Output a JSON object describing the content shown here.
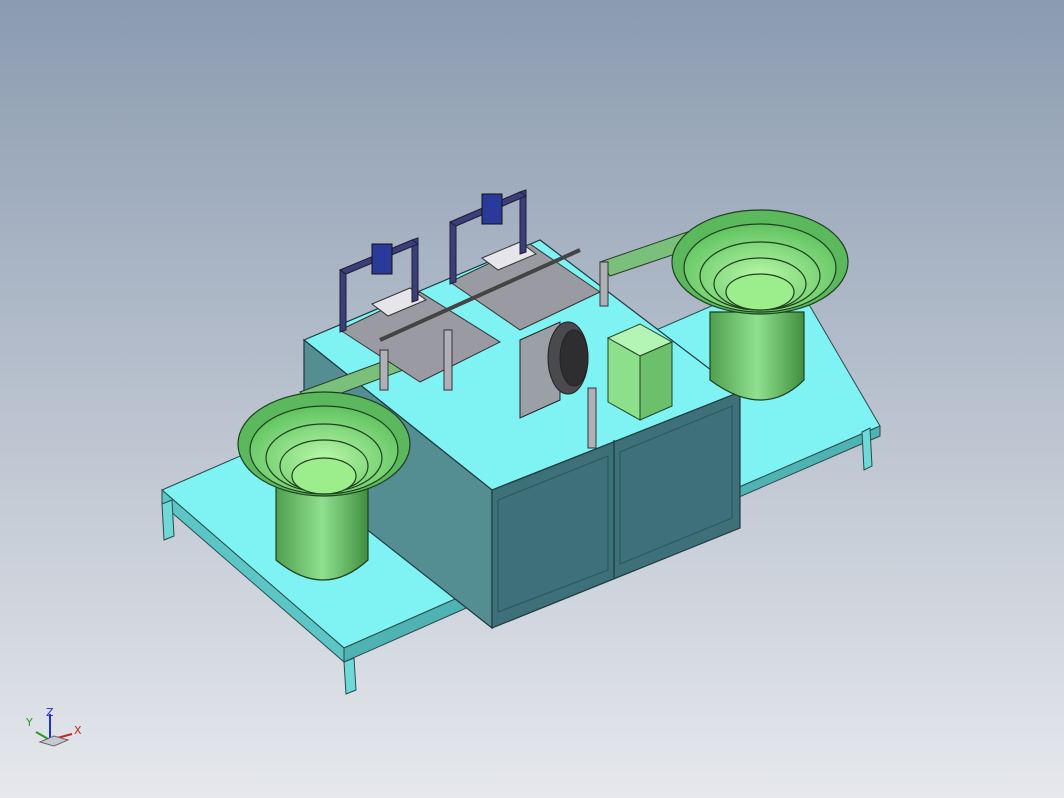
{
  "viewport": {
    "background_top": "#8b9bb0",
    "background_bottom": "#e6e8ec"
  },
  "model": {
    "colors": {
      "table_top": "#7ff3f3",
      "table_side": "#4fb3b3",
      "cabinet_front": "#3d7078",
      "cabinet_side": "#558e92",
      "bowl_green": "#7be07b",
      "bowl_dark": "#4c9a4c",
      "frame_gray": "#8e8e96",
      "motor_blue": "#2a3a9a",
      "box_green": "#8ce08c"
    }
  },
  "triad": {
    "x_label": "X",
    "y_label": "Y",
    "z_label": "Z",
    "x_color": "#d02020",
    "y_color": "#20a020",
    "z_color": "#2030d0"
  }
}
